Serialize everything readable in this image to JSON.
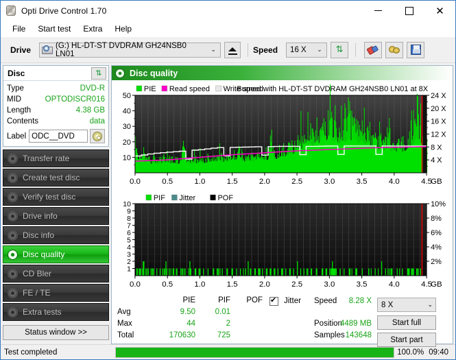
{
  "window": {
    "title": "Opti Drive Control 1.70",
    "app_icon": "disc-icon",
    "minimize": "–",
    "maximize": "□",
    "close": "✕"
  },
  "menu": {
    "items": [
      "File",
      "Start test",
      "Extra",
      "Help"
    ]
  },
  "toolbar": {
    "drive_label": "Drive",
    "drive_value": "(G:)   HL-DT-ST DVDRAM GH24NSB0 LN01",
    "eject_title": "eject",
    "speed_label": "Speed",
    "speed_value": "16 X",
    "refresh_icon": "⇅",
    "erase_icon": "eraser-icon",
    "bulb_icon": "plug-icon",
    "save_icon": "floppy-icon"
  },
  "disc": {
    "header": "Disc",
    "refresh_icon": "⇅",
    "rows": [
      {
        "key": "Type",
        "value": "DVD-R"
      },
      {
        "key": "MID",
        "value": "OPTODISCR016"
      },
      {
        "key": "Length",
        "value": "4.38 GB"
      },
      {
        "key": "Contents",
        "value": "data"
      }
    ],
    "label_key": "Label",
    "label_value": "ODC__DVD",
    "cd_icon": "cd-icon"
  },
  "nav": {
    "items": [
      {
        "label": "Transfer rate",
        "active": false
      },
      {
        "label": "Create test disc",
        "active": false
      },
      {
        "label": "Verify test disc",
        "active": false
      },
      {
        "label": "Drive info",
        "active": false
      },
      {
        "label": "Disc info",
        "active": false
      },
      {
        "label": "Disc quality",
        "active": true
      },
      {
        "label": "CD Bler",
        "active": false
      },
      {
        "label": "FE / TE",
        "active": false
      },
      {
        "label": "Extra tests",
        "active": false
      }
    ],
    "status_window": "Status window >>"
  },
  "panel": {
    "title": "Disc quality",
    "icon": "disc-quality-icon"
  },
  "stats": {
    "col_pie": "PIE",
    "col_pif": "PIF",
    "col_pof": "POF",
    "jitter_label": "Jitter",
    "jitter_checked": true,
    "rows": [
      {
        "label": "Avg",
        "pie": "9.50",
        "pif": "0.01",
        "pof": ""
      },
      {
        "label": "Max",
        "pie": "44",
        "pif": "2",
        "pof": ""
      },
      {
        "label": "Total",
        "pie": "170630",
        "pif": "725",
        "pof": ""
      }
    ],
    "speed_label": "Speed",
    "speed_value": "8.28 X",
    "position_label": "Position",
    "position_value": "4489 MB",
    "samples_label": "Samples",
    "samples_value": "143648",
    "test_speed": "8 X",
    "start_full": "Start full",
    "start_part": "Start part"
  },
  "statusbar": {
    "message": "Test completed",
    "percent": "100.0%",
    "progress": 100,
    "time": "09:40"
  },
  "colors": {
    "pie_green": "#00e000",
    "read_speed_magenta": "#ff00c8",
    "write_speed_white": "#ffffff",
    "pof_black": "#000000",
    "jitter_teal": "#4a8a8a",
    "accent_green": "#19a319",
    "marker_red": "#ff0000"
  },
  "chart_data": [
    {
      "type": "area",
      "id": "pie-chart",
      "title": "",
      "annotation": "Burned with HL-DT-ST DVDRAM GH24NSB0 LN01 at 8X",
      "legend": [
        "PIE",
        "Read speed",
        "Write speed"
      ],
      "legend_colors": [
        "#00e000",
        "#ff00c8",
        "#e8e8e8"
      ],
      "xlabel": "GB",
      "ylabel": "",
      "xlim": [
        0.0,
        4.5
      ],
      "ylim": [
        0,
        50
      ],
      "y2lim": [
        0,
        24
      ],
      "y2label": "X",
      "yticks": [
        10,
        20,
        30,
        40,
        50
      ],
      "xticks": [
        "0.0",
        "0.5",
        "1.0",
        "1.5",
        "2.0",
        "2.5",
        "3.0",
        "3.5",
        "4.0",
        "4.5"
      ],
      "y2ticks": [
        "4 X",
        "8 X",
        "12 X",
        "16 X",
        "20 X",
        "24 X"
      ],
      "grid": true,
      "series": [
        {
          "name": "PIE",
          "color": "#00e000",
          "x": [
            0.0,
            0.05,
            0.1,
            0.15,
            0.2,
            0.25,
            0.3,
            0.35,
            0.4,
            0.45,
            0.5,
            0.55,
            0.6,
            0.65,
            0.7,
            0.75,
            0.8,
            0.85,
            0.9,
            0.95,
            1.0,
            1.05,
            1.1,
            1.15,
            1.2,
            1.25,
            1.3,
            1.35,
            1.4,
            1.45,
            1.5,
            1.55,
            1.6,
            1.65,
            1.7,
            1.75,
            1.8,
            1.85,
            1.9,
            1.95,
            2.0,
            2.05,
            2.1,
            2.15,
            2.2,
            2.25,
            2.3,
            2.35,
            2.4,
            2.45,
            2.5,
            2.55,
            2.6,
            2.65,
            2.7,
            2.75,
            2.8,
            2.85,
            2.9,
            2.95,
            3.0,
            3.05,
            3.1,
            3.15,
            3.2,
            3.25,
            3.3,
            3.35,
            3.4,
            3.45,
            3.5,
            3.55,
            3.6,
            3.65,
            3.7,
            3.75,
            3.8,
            3.85,
            3.9,
            3.95,
            4.0,
            4.05,
            4.1,
            4.15,
            4.2,
            4.25,
            4.3,
            4.35,
            4.4,
            4.45
          ],
          "values": [
            20,
            14,
            17,
            12,
            14,
            10,
            13,
            9,
            12,
            10,
            13,
            11,
            12,
            10,
            11,
            25,
            11,
            10,
            12,
            11,
            13,
            11,
            12,
            13,
            14,
            13,
            16,
            12,
            14,
            13,
            16,
            13,
            22,
            14,
            13,
            15,
            14,
            13,
            19,
            14,
            16,
            15,
            28,
            17,
            16,
            20,
            19,
            20,
            24,
            22,
            26,
            31,
            25,
            28,
            35,
            30,
            38,
            34,
            43,
            37,
            44,
            36,
            40,
            34,
            38,
            36,
            41,
            37,
            42,
            34,
            39,
            33,
            36,
            30,
            32,
            27,
            29,
            26,
            30,
            25,
            27,
            24,
            26,
            23,
            28,
            30,
            33,
            42,
            35,
            30
          ]
        },
        {
          "name": "Read speed",
          "color": "#ff00c8",
          "axis": "y2",
          "x": [
            0.0,
            0.25,
            0.5,
            0.75,
            1.0,
            1.25,
            1.5,
            1.75,
            2.0,
            2.25,
            2.5,
            2.75,
            3.0,
            3.25,
            3.5,
            3.75,
            4.0,
            4.25,
            4.45
          ],
          "values": [
            3.6,
            3.8,
            4.0,
            4.4,
            4.8,
            5.2,
            5.6,
            5.9,
            6.2,
            6.5,
            6.8,
            7.0,
            7.2,
            7.4,
            7.6,
            7.8,
            7.9,
            8.0,
            8.1
          ]
        },
        {
          "name": "Write speed",
          "color": "#ffffff",
          "axis": "y2",
          "x": [
            0.0,
            0.25,
            0.5,
            0.75,
            1.0,
            1.25,
            1.5,
            1.75,
            2.0,
            2.25,
            2.5,
            2.75,
            3.0,
            3.25,
            3.5,
            3.75,
            4.0,
            4.25,
            4.45
          ],
          "values": [
            5.2,
            6.0,
            6.4,
            6.8,
            7.2,
            7.8,
            7.9,
            8.0,
            8.1,
            8.2,
            8.2,
            8.2,
            8.3,
            8.3,
            8.3,
            8.3,
            8.3,
            8.3,
            8.3
          ]
        }
      ]
    },
    {
      "type": "bar",
      "id": "pif-chart",
      "legend": [
        "PIF",
        "Jitter",
        "POF"
      ],
      "legend_colors": [
        "#00e000",
        "#4a8a8a",
        "#000000"
      ],
      "xlabel": "GB",
      "xlim": [
        0.0,
        4.5
      ],
      "ylim": [
        0,
        10
      ],
      "y2lim": [
        0,
        10
      ],
      "yticks": [
        1,
        2,
        3,
        4,
        5,
        6,
        7,
        8,
        9,
        10
      ],
      "xticks": [
        "0.0",
        "0.5",
        "1.0",
        "1.5",
        "2.0",
        "2.5",
        "3.0",
        "3.5",
        "4.0",
        "4.5"
      ],
      "y2ticks": [
        "2%",
        "4%",
        "6%",
        "8%",
        "10%"
      ],
      "grid": true,
      "series": [
        {
          "name": "PIF",
          "color": "#00e000",
          "x": [
            0.02,
            0.06,
            0.12,
            0.13,
            0.16,
            0.2,
            0.24,
            0.28,
            0.33,
            0.38,
            0.42,
            0.47,
            0.52,
            0.58,
            0.63,
            0.7,
            0.76,
            0.84,
            0.85,
            0.92,
            0.98,
            1.05,
            1.12,
            1.2,
            1.28,
            1.34,
            1.42,
            1.5,
            1.56,
            1.62,
            1.7,
            1.74,
            1.78,
            1.84,
            1.9,
            1.96,
            2.02,
            2.08,
            2.14,
            2.2,
            2.26,
            2.32,
            2.38,
            2.44,
            2.5,
            2.55,
            2.6,
            2.66,
            2.72,
            2.8,
            2.88,
            2.94,
            3.0,
            3.04,
            3.06,
            3.1,
            3.16,
            3.22,
            3.3,
            3.4,
            3.5,
            3.6,
            3.7,
            3.8,
            3.86,
            3.9,
            3.96,
            4.04,
            4.12,
            4.2,
            4.28,
            4.34,
            4.4
          ],
          "values": [
            1,
            1,
            2,
            2,
            1,
            1,
            1,
            1,
            1,
            1,
            1,
            2,
            1,
            1,
            1,
            1,
            1,
            2,
            1,
            1,
            1,
            1,
            1,
            1,
            1,
            1,
            1,
            1,
            1,
            1,
            1,
            2,
            1,
            1,
            1,
            1,
            1,
            1,
            1,
            1,
            1,
            1,
            1,
            1,
            2,
            1,
            1,
            1,
            1,
            1,
            1,
            1,
            1,
            2,
            1,
            1,
            1,
            1,
            1,
            1,
            1,
            1,
            1,
            2,
            1,
            1,
            1,
            1,
            1,
            1,
            1,
            1,
            1
          ]
        }
      ]
    }
  ]
}
